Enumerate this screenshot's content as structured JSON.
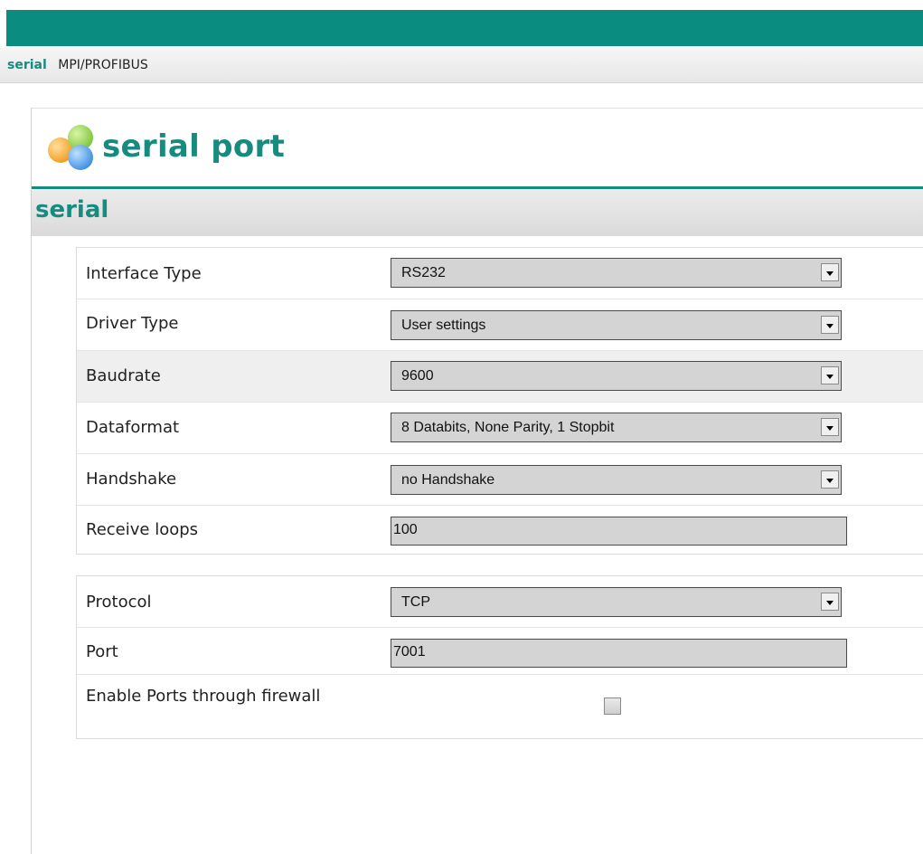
{
  "nav": {
    "tabs": [
      {
        "label": "serial",
        "active": true
      },
      {
        "label": "MPI/PROFIBUS",
        "active": false
      }
    ]
  },
  "header": {
    "title": "serial port",
    "logo_icon": "colored-bubbles-logo-icon"
  },
  "section": {
    "title": "serial"
  },
  "serial_settings": [
    {
      "label": "Interface Type",
      "type": "select",
      "value": "RS232"
    },
    {
      "label": "Driver Type",
      "type": "select",
      "value": "User settings"
    },
    {
      "label": "Baudrate",
      "type": "select",
      "value": "9600"
    },
    {
      "label": "Dataformat",
      "type": "select",
      "value": "8 Databits, None Parity, 1 Stopbit"
    },
    {
      "label": "Handshake",
      "type": "select",
      "value": "no Handshake"
    },
    {
      "label": "Receive loops",
      "type": "text",
      "value": "100"
    }
  ],
  "network_settings": [
    {
      "label": "Protocol",
      "type": "select",
      "value": "TCP"
    },
    {
      "label": "Port",
      "type": "text",
      "value": "7001"
    },
    {
      "label": "Enable Ports through firewall",
      "type": "checkbox",
      "checked": false
    }
  ],
  "colors": {
    "accent": "#168c80",
    "topbar": "#0b8c80",
    "field_bg": "#d4d4d4"
  }
}
